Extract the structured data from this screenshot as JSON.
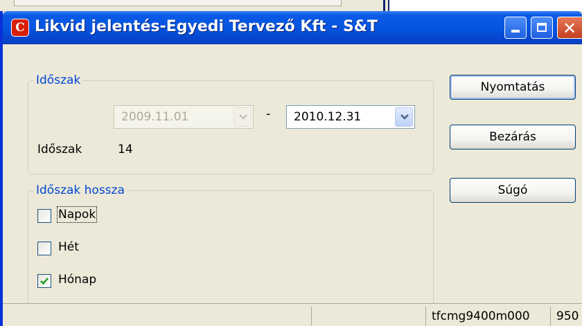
{
  "window": {
    "title": "Likvid jelentés-Egyedi Tervező  Kft - S&T",
    "icon_glyph": "C",
    "close_glyph": "✕"
  },
  "period_group": {
    "legend": "Időszak",
    "from_date": "2009.11.01",
    "separator": "-",
    "to_date": "2010.12.31",
    "count_label": "Időszak",
    "count_value": "14"
  },
  "length_group": {
    "legend": "Időszak hossza",
    "options": [
      {
        "label": "Napok",
        "checked": false
      },
      {
        "label": "Hét",
        "checked": false
      },
      {
        "label": "Hónap",
        "checked": true
      }
    ]
  },
  "buttons": {
    "print": "Nyomtatás",
    "close": "Bezárás",
    "help": "Súgó"
  },
  "statusbar": {
    "pane1": "",
    "session": "tfcmg9400m000",
    "company": "950"
  },
  "colors": {
    "title_blue": "#0655e0",
    "legend_blue": "#0046d5",
    "check_green": "#21a121",
    "close_red": "#c2401d"
  }
}
